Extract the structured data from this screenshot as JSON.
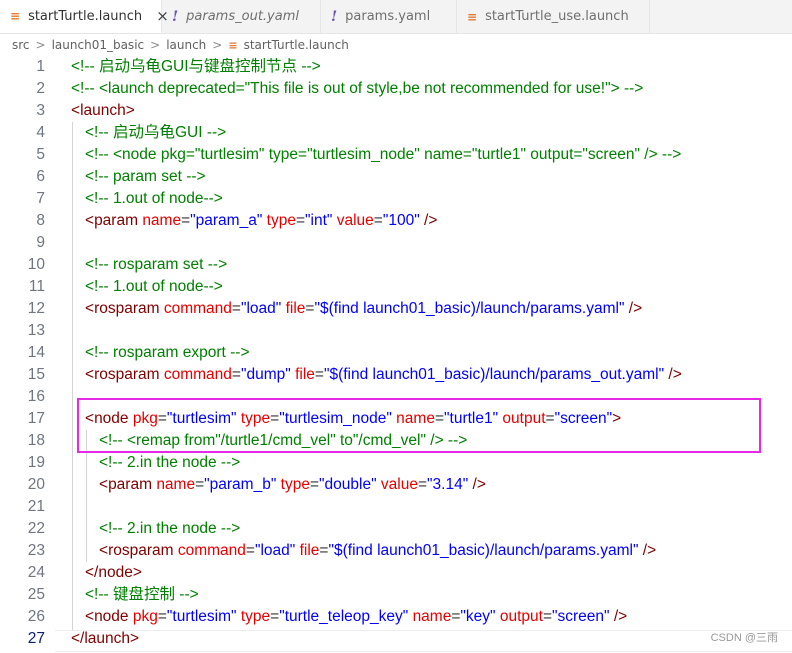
{
  "tabs": [
    {
      "label": "startTurtle.launch",
      "icon": "rss-icon",
      "active": true,
      "close": "×"
    },
    {
      "label": "params_out.yaml",
      "icon": "warning-bang-icon",
      "italic": true
    },
    {
      "label": "params.yaml",
      "icon": "warning-bang-icon"
    },
    {
      "label": "startTurtle_use.launch",
      "icon": "rss-icon"
    }
  ],
  "breadcrumb": [
    "src",
    "launch01_basic",
    "launch",
    "startTurtle.launch"
  ],
  "current_line": 27,
  "lines": [
    {
      "n": 1,
      "code": "<!-- 启动乌龟GUI与键盘控制节点 -->"
    },
    {
      "n": 2,
      "code": "<!-- <launch deprecated=\"This file is out of style,be not recommended for use!\"> -->"
    },
    {
      "n": 3,
      "code": "<launch>"
    },
    {
      "n": 4,
      "code": "  <!-- 启动乌龟GUI -->"
    },
    {
      "n": 5,
      "code": "  <!-- <node pkg=\"turtlesim\" type=\"turtlesim_node\" name=\"turtle1\" output=\"screen\" /> -->"
    },
    {
      "n": 6,
      "code": "  <!-- param set -->"
    },
    {
      "n": 7,
      "code": "  <!-- 1.out of node-->"
    },
    {
      "n": 8,
      "code": "  <param name=\"param_a\" type=\"int\" value=\"100\" />"
    },
    {
      "n": 9,
      "code": ""
    },
    {
      "n": 10,
      "code": "  <!-- rosparam set -->"
    },
    {
      "n": 11,
      "code": "  <!-- 1.out of node-->"
    },
    {
      "n": 12,
      "code": "  <rosparam command=\"load\" file=\"$(find launch01_basic)/launch/params.yaml\" />"
    },
    {
      "n": 13,
      "code": ""
    },
    {
      "n": 14,
      "code": "  <!-- rosparam export -->"
    },
    {
      "n": 15,
      "code": "  <rosparam command=\"dump\" file=\"$(find launch01_basic)/launch/params_out.yaml\" />"
    },
    {
      "n": 16,
      "code": ""
    },
    {
      "n": 17,
      "code": "  <node pkg=\"turtlesim\" type=\"turtlesim_node\" name=\"turtle1\" output=\"screen\">"
    },
    {
      "n": 18,
      "code": "    <!-- <remap from\"/turtle1/cmd_vel\" to\"/cmd_vel\" /> -->"
    },
    {
      "n": 19,
      "code": "    <!-- 2.in the node -->"
    },
    {
      "n": 20,
      "code": "    <param name=\"param_b\" type=\"double\" value=\"3.14\" />"
    },
    {
      "n": 21,
      "code": ""
    },
    {
      "n": 22,
      "code": "    <!-- 2.in the node -->"
    },
    {
      "n": 23,
      "code": "    <rosparam command=\"load\" file=\"$(find launch01_basic)/launch/params.yaml\" />"
    },
    {
      "n": 24,
      "code": "  </node>"
    },
    {
      "n": 25,
      "code": "  <!-- 键盘控制 -->"
    },
    {
      "n": 26,
      "code": "  <node pkg=\"turtlesim\" type=\"turtle_teleop_key\" name=\"key\" output=\"screen\" />"
    },
    {
      "n": 27,
      "code": "</launch>"
    }
  ],
  "highlight_color": "#e629e6",
  "watermark": "CSDN @三雨"
}
